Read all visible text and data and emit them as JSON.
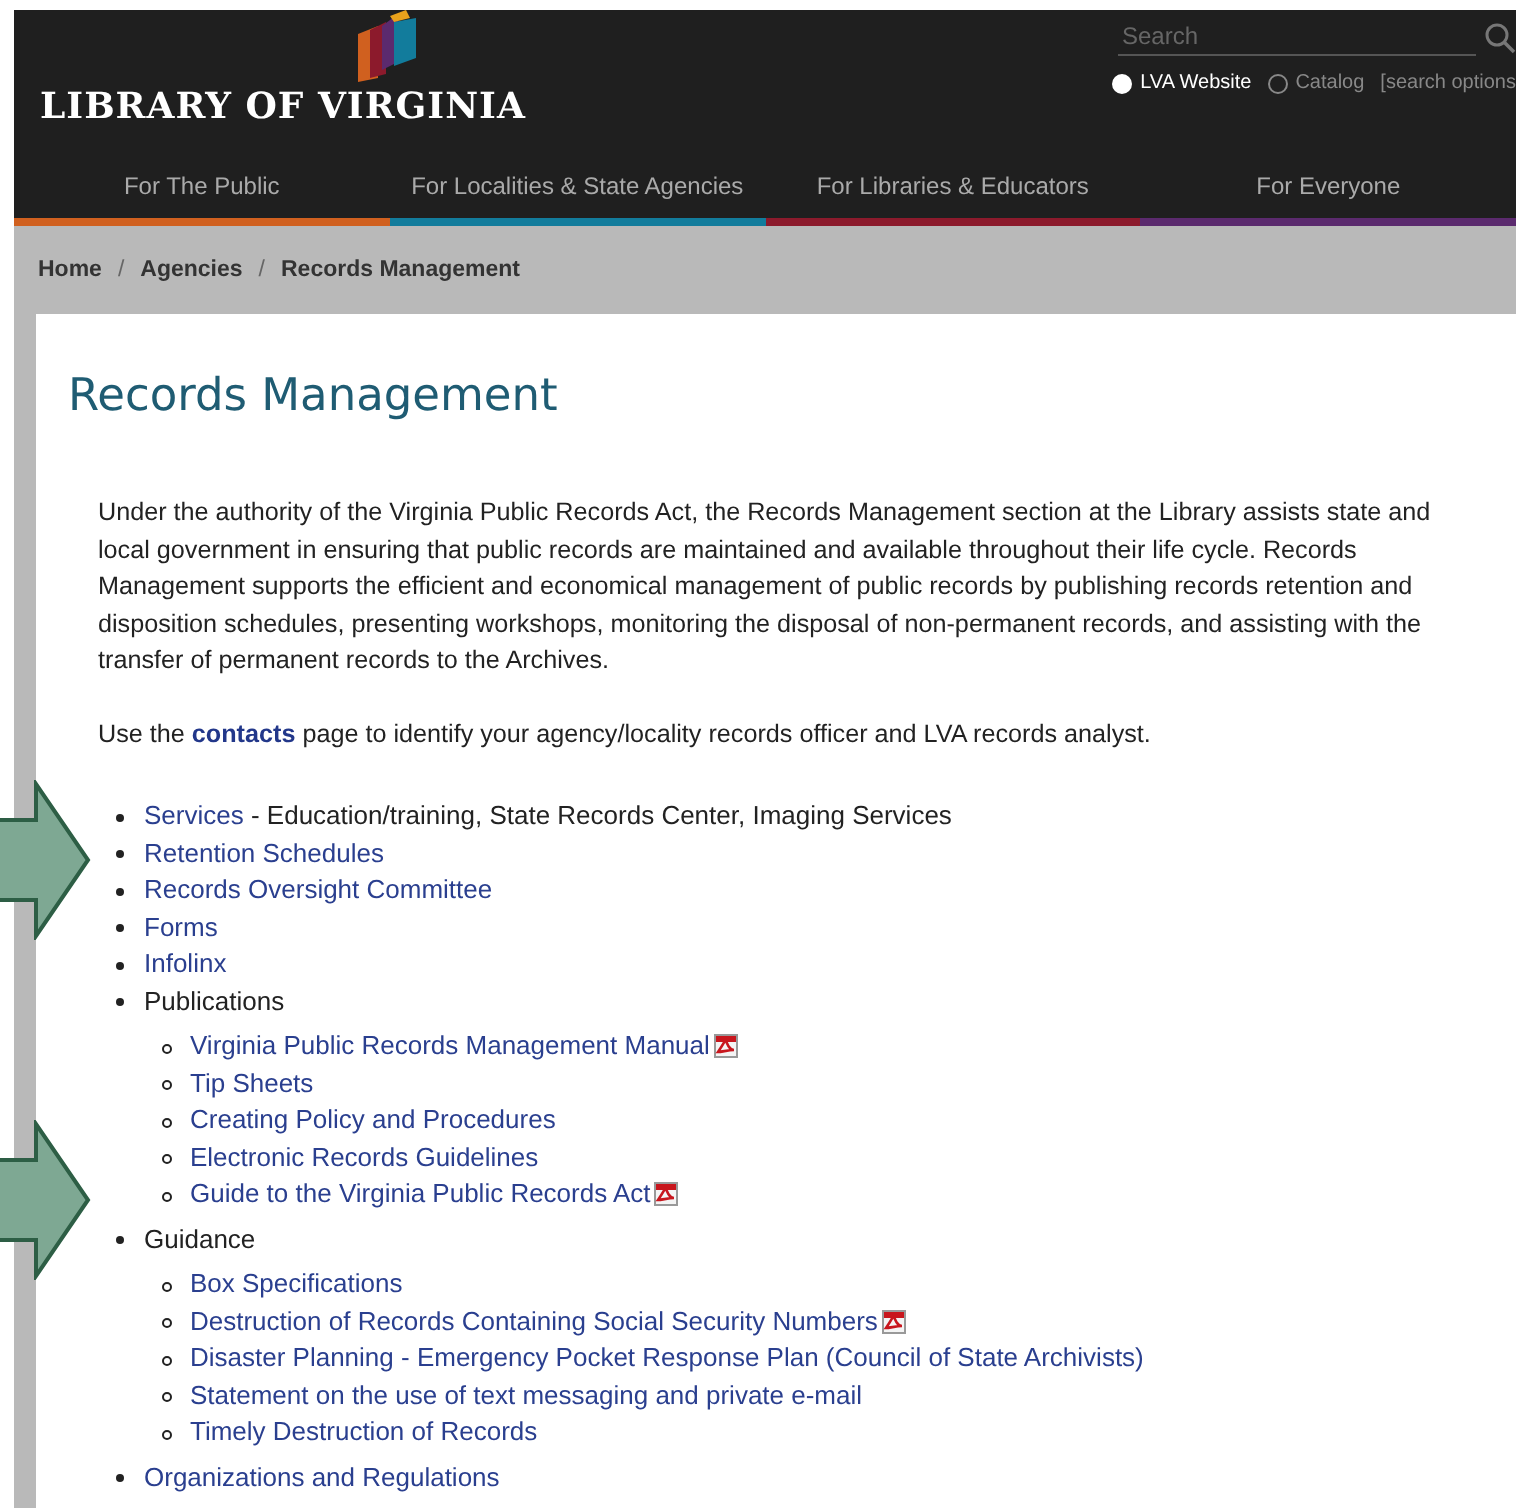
{
  "header": {
    "logo_text": "LIBRARY OF VIRGINIA",
    "search": {
      "placeholder": "Search"
    },
    "scopes": [
      {
        "label": "LVA Website",
        "selected": true
      },
      {
        "label": "Catalog",
        "selected": false
      }
    ],
    "options_link": "[search options"
  },
  "nav": [
    {
      "label": "For The Public",
      "color": "#d0601f"
    },
    {
      "label": "For Localities & State Agencies",
      "color": "#127c9c"
    },
    {
      "label": "For Libraries & Educators",
      "color": "#8c1a2c"
    },
    {
      "label": "For Everyone",
      "color": "#5b2a6e"
    }
  ],
  "breadcrumb": [
    "Home",
    "Agencies",
    "Records Management"
  ],
  "breadcrumb_separator": "/",
  "title": "Records Management",
  "intro": "Under the authority of the Virginia Public Records Act, the Records Management section at the Library assists state and local government in ensuring that public records are maintained and available throughout their life cycle. Records Management supports the efficient and economical management of public records by publishing records retention and disposition schedules, presenting workshops, monitoring the disposal of non-permanent records, and assisting with the transfer of permanent records to the Archives.",
  "contacts_line": {
    "before": "Use the ",
    "link": "contacts",
    "after": " page to identify your agency/locality records officer and LVA records analyst."
  },
  "items": [
    {
      "kind": "link",
      "label": "Services",
      "suffix": " - Education/training, State Records Center, Imaging Services"
    },
    {
      "kind": "link",
      "label": "Retention Schedules"
    },
    {
      "kind": "link",
      "label": "Records Oversight Committee"
    },
    {
      "kind": "link",
      "label": "Forms"
    },
    {
      "kind": "link",
      "label": "Infolinx"
    },
    {
      "kind": "heading",
      "label": "Publications",
      "children": [
        {
          "kind": "link",
          "label": "Virginia Public Records Management Manual",
          "pdf": true
        },
        {
          "kind": "link",
          "label": "Tip Sheets"
        },
        {
          "kind": "link",
          "label": "Creating Policy and Procedures"
        },
        {
          "kind": "link",
          "label": "Electronic Records Guidelines"
        },
        {
          "kind": "link",
          "label": "Guide to the Virginia Public Records Act",
          "pdf": true
        }
      ]
    },
    {
      "kind": "heading",
      "label": "Guidance",
      "children": [
        {
          "kind": "link",
          "label": "Box Specifications"
        },
        {
          "kind": "link",
          "label": "Destruction of Records Containing Social Security Numbers",
          "pdf": true
        },
        {
          "kind": "link",
          "label": "Disaster Planning - Emergency Pocket Response Plan (Council of State Archivists)"
        },
        {
          "kind": "link",
          "label": "Statement on the use of text messaging and private e-mail"
        },
        {
          "kind": "link",
          "label": "Timely Destruction of Records"
        }
      ]
    },
    {
      "kind": "link",
      "label": "Organizations and Regulations"
    }
  ]
}
